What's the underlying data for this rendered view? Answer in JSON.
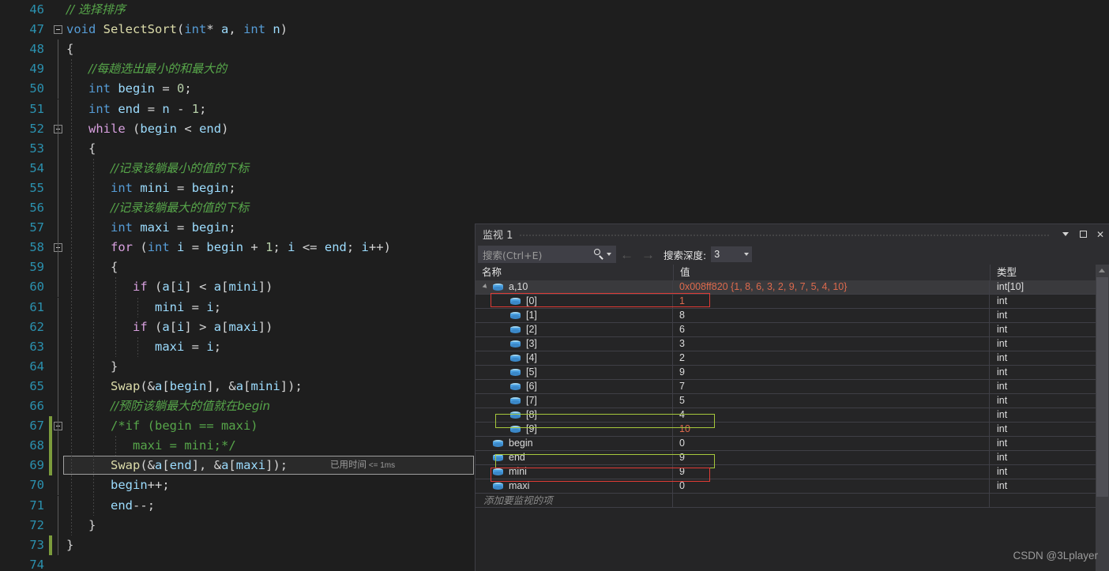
{
  "editor": {
    "language": "cpp",
    "lines": [
      {
        "num": "46",
        "indent": 0,
        "text": "// 选择排序"
      },
      {
        "num": "47",
        "indent": 0,
        "text": "void SelectSort(int* a, int n)"
      },
      {
        "num": "48",
        "indent": 0,
        "text": "{"
      },
      {
        "num": "49",
        "indent": 1,
        "text": "//每趟选出最小的和最大的"
      },
      {
        "num": "50",
        "indent": 1,
        "text": "int begin = 0;"
      },
      {
        "num": "51",
        "indent": 1,
        "text": "int end = n - 1;"
      },
      {
        "num": "52",
        "indent": 1,
        "text": "while (begin < end)"
      },
      {
        "num": "53",
        "indent": 1,
        "text": "{"
      },
      {
        "num": "54",
        "indent": 2,
        "text": "//记录该躺最小的值的下标"
      },
      {
        "num": "55",
        "indent": 2,
        "text": "int mini = begin;"
      },
      {
        "num": "56",
        "indent": 2,
        "text": "//记录该躺最大的值的下标"
      },
      {
        "num": "57",
        "indent": 2,
        "text": "int maxi = begin;"
      },
      {
        "num": "58",
        "indent": 2,
        "text": "for (int i = begin + 1; i <= end; i++)"
      },
      {
        "num": "59",
        "indent": 2,
        "text": "{"
      },
      {
        "num": "60",
        "indent": 3,
        "text": "if (a[i] < a[mini])"
      },
      {
        "num": "61",
        "indent": 4,
        "text": "mini = i;"
      },
      {
        "num": "62",
        "indent": 3,
        "text": "if (a[i] > a[maxi])"
      },
      {
        "num": "63",
        "indent": 4,
        "text": "maxi = i;"
      },
      {
        "num": "64",
        "indent": 2,
        "text": "}"
      },
      {
        "num": "65",
        "indent": 2,
        "text": "Swap(&a[begin], &a[mini]);"
      },
      {
        "num": "66",
        "indent": 2,
        "text": "//预防该躺最大的值就在begin"
      },
      {
        "num": "67",
        "indent": 2,
        "text": "/*if (begin == maxi)"
      },
      {
        "num": "68",
        "indent": 3,
        "text": "maxi = mini;*/"
      },
      {
        "num": "69",
        "indent": 2,
        "text": "Swap(&a[end], &a[maxi]);"
      },
      {
        "num": "70",
        "indent": 2,
        "text": "begin++;"
      },
      {
        "num": "71",
        "indent": 2,
        "text": "end--;"
      },
      {
        "num": "72",
        "indent": 1,
        "text": "}"
      },
      {
        "num": "73",
        "indent": 0,
        "text": "}"
      },
      {
        "num": "74",
        "indent": 0,
        "text": ""
      }
    ],
    "current_line": "69",
    "elapsed_time_label": "已用时间",
    "elapsed_time_value": "<= 1ms"
  },
  "watch_window": {
    "title": "监视 1",
    "search_placeholder": "搜索(Ctrl+E)",
    "search_value": "",
    "search_icon": "magnifier-icon",
    "prev_icon": "arrow-left-icon",
    "next_icon": "arrow-right-icon",
    "depth_label": "搜索深度:",
    "depth_value": "3",
    "window_dropdown_icon": "chevron-down-icon",
    "window_maximize_icon": "maximize-icon",
    "window_close_icon": "close-icon",
    "columns": [
      "名称",
      "值",
      "类型"
    ],
    "add_item_placeholder": "添加要监视的项",
    "rows": [
      {
        "name": "a,10",
        "value": "0x008ff820 {1, 8, 6, 3, 2, 9, 7, 5, 4, 10}",
        "type": "int[10]",
        "depth": 0,
        "expander": true,
        "selected": true,
        "value_color": "red"
      },
      {
        "name": "[0]",
        "value": "1",
        "type": "int",
        "depth": 1,
        "expander": false,
        "selected": false,
        "value_color": "red"
      },
      {
        "name": "[1]",
        "value": "8",
        "type": "int",
        "depth": 1,
        "expander": false,
        "selected": false,
        "value_color": "white"
      },
      {
        "name": "[2]",
        "value": "6",
        "type": "int",
        "depth": 1,
        "expander": false,
        "selected": false,
        "value_color": "white"
      },
      {
        "name": "[3]",
        "value": "3",
        "type": "int",
        "depth": 1,
        "expander": false,
        "selected": false,
        "value_color": "white"
      },
      {
        "name": "[4]",
        "value": "2",
        "type": "int",
        "depth": 1,
        "expander": false,
        "selected": false,
        "value_color": "white"
      },
      {
        "name": "[5]",
        "value": "9",
        "type": "int",
        "depth": 1,
        "expander": false,
        "selected": false,
        "value_color": "white"
      },
      {
        "name": "[6]",
        "value": "7",
        "type": "int",
        "depth": 1,
        "expander": false,
        "selected": false,
        "value_color": "white"
      },
      {
        "name": "[7]",
        "value": "5",
        "type": "int",
        "depth": 1,
        "expander": false,
        "selected": false,
        "value_color": "white"
      },
      {
        "name": "[8]",
        "value": "4",
        "type": "int",
        "depth": 1,
        "expander": false,
        "selected": false,
        "value_color": "white"
      },
      {
        "name": "[9]",
        "value": "10",
        "type": "int",
        "depth": 1,
        "expander": false,
        "selected": false,
        "value_color": "red"
      },
      {
        "name": "begin",
        "value": "0",
        "type": "int",
        "depth": 0,
        "expander": false,
        "selected": false,
        "value_color": "white"
      },
      {
        "name": "end",
        "value": "9",
        "type": "int",
        "depth": 0,
        "expander": false,
        "selected": false,
        "value_color": "white"
      },
      {
        "name": "mini",
        "value": "9",
        "type": "int",
        "depth": 0,
        "expander": false,
        "selected": false,
        "value_color": "white"
      },
      {
        "name": "maxi",
        "value": "0",
        "type": "int",
        "depth": 0,
        "expander": false,
        "selected": false,
        "value_color": "white"
      }
    ],
    "annotations": [
      {
        "target_row": "[0]",
        "color": "#e03b35",
        "shape": "rect"
      },
      {
        "target_row": "[9]",
        "color": "#a6c83c",
        "shape": "rect"
      },
      {
        "target_row": "mini",
        "color": "#a6c83c",
        "shape": "rect"
      },
      {
        "target_row": "maxi",
        "color": "#e03b35",
        "shape": "rect"
      }
    ]
  },
  "watermark": "CSDN @3Lplayer",
  "colors": {
    "editor_bg": "#1e1e1e",
    "panel_bg": "#2d2d30",
    "grid_bg": "#252526",
    "line_number": "#2b91af",
    "comment": "#57a64a",
    "keyword": "#569cd6",
    "control_keyword": "#d8a0df",
    "function": "#dcdcaa",
    "variable": "#9cdcfe",
    "number": "#b5cea8",
    "annotation_red": "#e03b35",
    "annotation_green": "#a6c83c",
    "change_bar": "#7c9c3c"
  }
}
